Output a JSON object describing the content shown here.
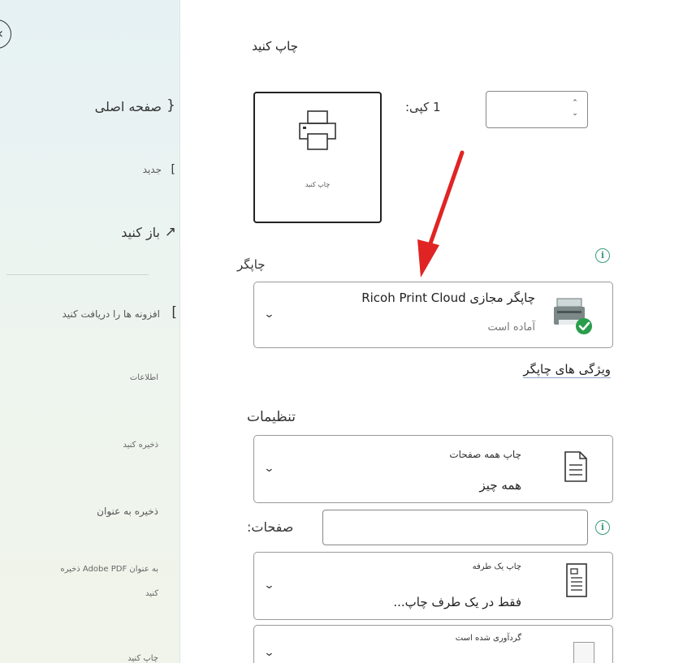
{
  "sidebar": {
    "home_label": "صفحه اصلی",
    "new_label": "جدید",
    "open_label": "باز کنید",
    "addins_label": "افزونه ها را دریافت کنید",
    "info_label": "اطلاعات",
    "save_label": "ذخیره کنید",
    "save_as_label": "ذخیره به عنوان",
    "save_pdf_label_line1": "به عنوان Adobe PDF ذخیره",
    "save_pdf_label_line2": "کنید",
    "print_label": "چاپ کنید"
  },
  "main": {
    "title": "چاپ کنید",
    "print_button_label": "چاپ کنید",
    "copies": {
      "label": "کپی:",
      "value": "1"
    },
    "printer": {
      "section_label": "چاپگر",
      "name": "چاپگر مجازی Ricoh Print Cloud",
      "status": "آماده است",
      "properties_link": "ویژگی های چاپگر"
    },
    "settings": {
      "section_label": "تنظیمات",
      "range_title": "چاپ همه صفحات",
      "range_value": "همه چیز",
      "pages_label": "صفحات:",
      "pages_value": "",
      "sides_title": "چاپ یک طرفه",
      "sides_value": "فقط در یک طرف چاپ...",
      "collate_title": "گردآوری شده است"
    }
  },
  "colors": {
    "annotation_arrow": "#e02424",
    "ready_check": "#2a9d4b",
    "info_accent": "#3a9a7a"
  }
}
